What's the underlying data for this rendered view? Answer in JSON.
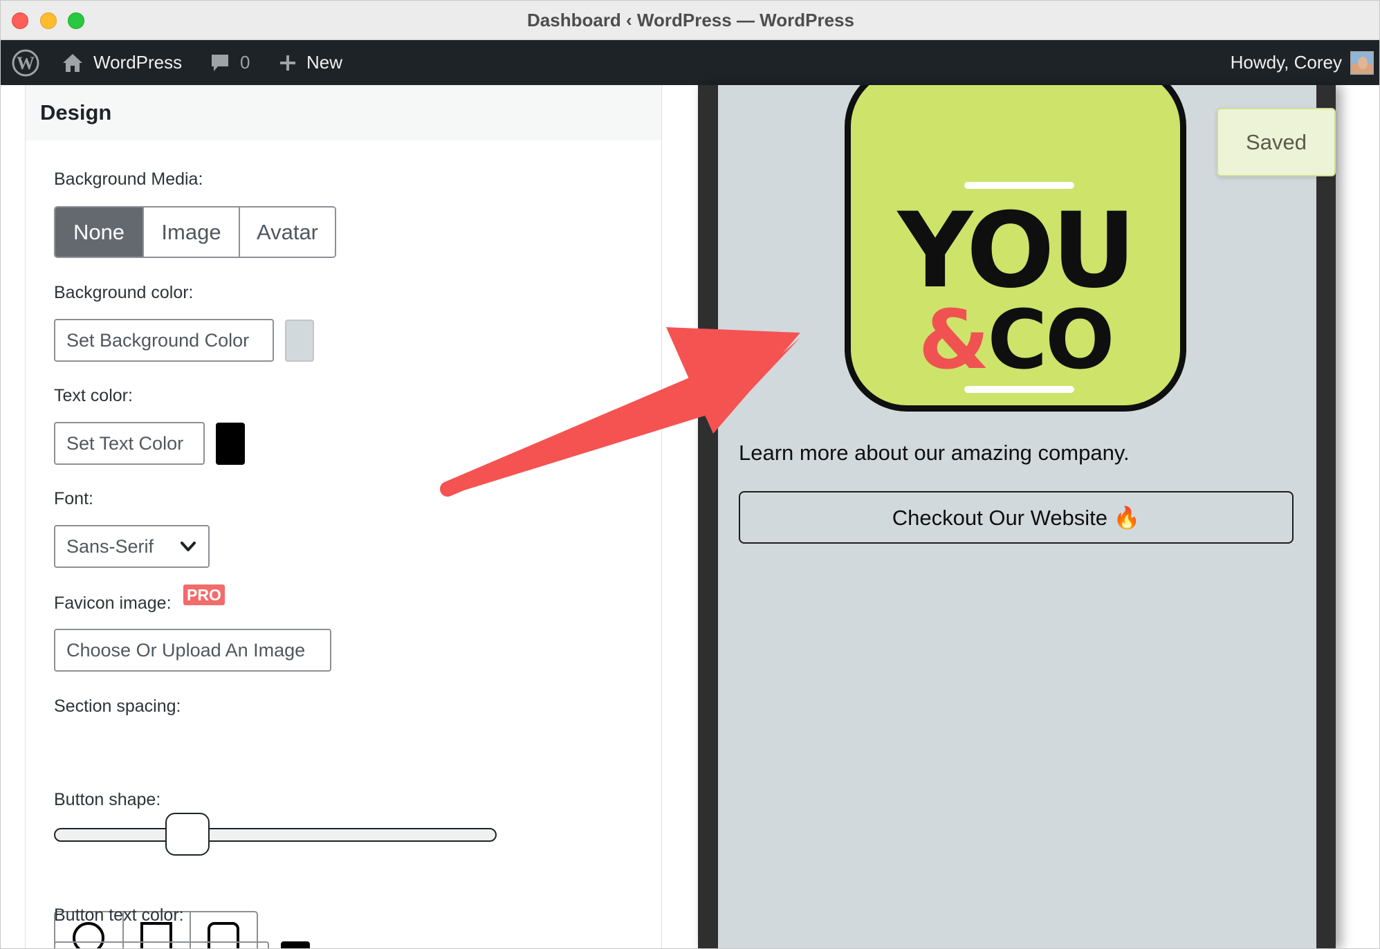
{
  "window": {
    "title": "Dashboard ‹ WordPress — WordPress"
  },
  "admin_bar": {
    "site_name": "WordPress",
    "comments_count": "0",
    "new_label": "New",
    "howdy": "Howdy, Corey"
  },
  "design_panel": {
    "title": "Design",
    "background_media": {
      "label": "Background Media:",
      "options": [
        "None",
        "Image",
        "Avatar"
      ],
      "selected": "None"
    },
    "background_color": {
      "label": "Background color:",
      "button": "Set Background Color",
      "value": "#d1d9dc"
    },
    "text_color": {
      "label": "Text color:",
      "button": "Set Text Color",
      "value": "#000000"
    },
    "font": {
      "label": "Font:",
      "selected": "Sans-Serif"
    },
    "favicon": {
      "label": "Favicon image:",
      "badge": "PRO",
      "button": "Choose Or Upload An Image"
    },
    "section_spacing": {
      "label": "Section spacing:",
      "value_fraction": 0.28
    },
    "button_shape": {
      "label": "Button shape:",
      "options": [
        "circle-icon",
        "square-icon",
        "rounded-square-icon"
      ]
    },
    "button_text_color": {
      "label": "Button text color:",
      "value": "#000000"
    }
  },
  "preview": {
    "logo": {
      "line1": "YOU",
      "amp": "&",
      "line2": "CO",
      "tile_color": "#cde36a",
      "amp_color": "#f05252"
    },
    "tagline": "Learn more about our amazing company.",
    "button_label": "Checkout Our Website 🔥",
    "toast": "Saved"
  }
}
